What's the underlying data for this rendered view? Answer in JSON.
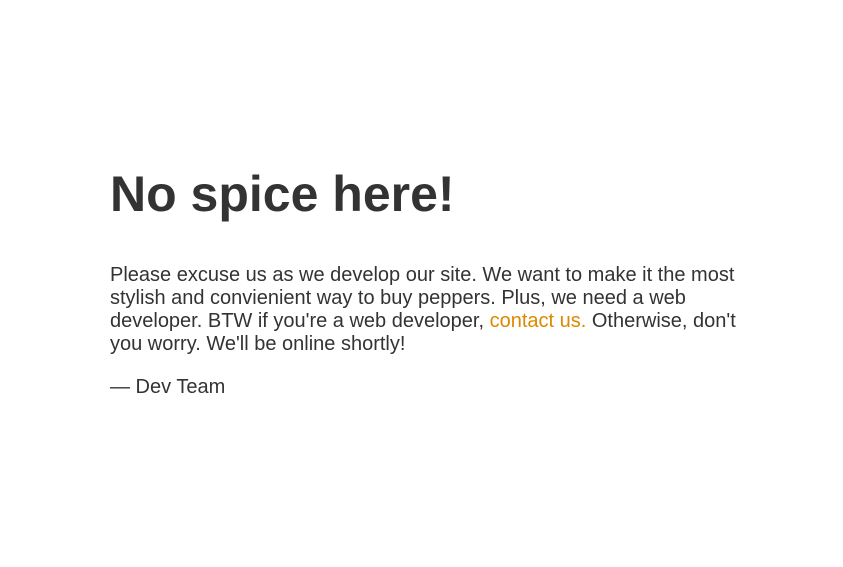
{
  "colors": {
    "text": "#333333",
    "link": "#dd8800",
    "background": "#ffffff"
  },
  "main": {
    "heading": "No spice here!",
    "message": {
      "before_link": "Please excuse us as we develop our site. We want to make it the most stylish and convienient way to buy peppers. Plus, we need a web developer. BTW if you're a web developer, ",
      "link_label": "contact us.",
      "after_link": " Otherwise, don't you worry. We'll be online shortly!"
    },
    "signature": "— Dev Team"
  }
}
